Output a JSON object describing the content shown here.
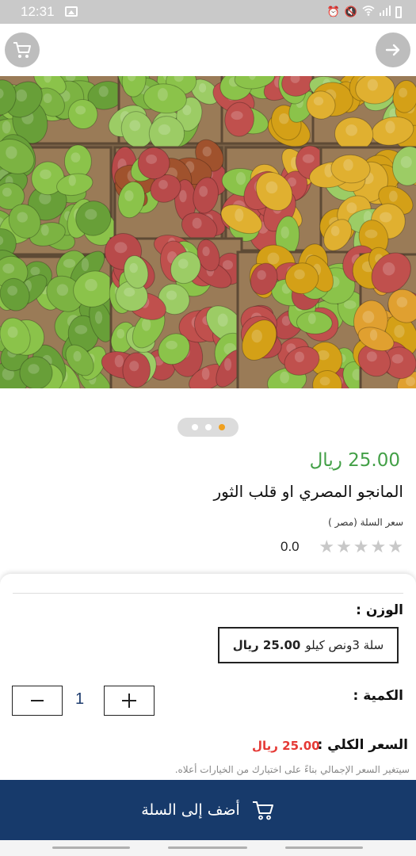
{
  "status_bar": {
    "time": "12:31",
    "icons": [
      "image-icon",
      "alarm-icon",
      "mute-icon",
      "wifi-icon",
      "signal-icon",
      "battery-icon"
    ]
  },
  "top_bar": {
    "left_icon": "cart-icon",
    "right_icon": "arrow-right-icon"
  },
  "carousel": {
    "page_count": 3,
    "active_index": 2
  },
  "product": {
    "price": "25.00 ريال",
    "name": "المانجو المصري او قلب الثور",
    "subtitle": "سعر السلة  (مصر )",
    "rating": "0.0",
    "rating_max": 5,
    "rating_value": 0
  },
  "options": {
    "weight_label": "الوزن :",
    "weight_option": {
      "name": "سلة 3ونص كيلو",
      "price": "25.00 ريال"
    },
    "quantity_label": "الكمية :",
    "quantity": "1",
    "total_label": "السعر الكلي :",
    "total_price": "25.00 ريال",
    "note": "سيتغير السعر الإجمالي بناءً على اختيارك من الخيارات أعلاه."
  },
  "add_to_cart": {
    "label": "أضف إلى السلة",
    "icon": "cart-icon"
  },
  "colors": {
    "accent_green": "#43a047",
    "brand_blue": "#173a6b",
    "price_red": "#e53935",
    "active_dot": "#f0a020"
  }
}
